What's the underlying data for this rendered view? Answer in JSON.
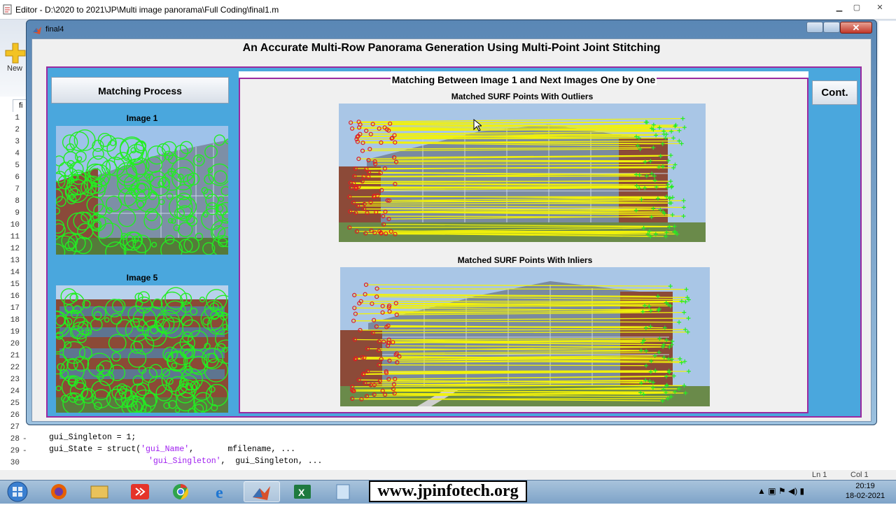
{
  "editor": {
    "title": "Editor - D:\\2020 to 2021\\JP\\Multi image panorama\\Full Coding\\final1.m",
    "new_label": "New",
    "tab_label": "fi",
    "line_numbers": [
      "1",
      "2",
      "3",
      "4",
      "5",
      "6",
      "7",
      "8",
      "9",
      "10",
      "11",
      "12",
      "13",
      "14",
      "15",
      "16",
      "17",
      "18",
      "19",
      "20",
      "21",
      "22",
      "23",
      "24",
      "25",
      "26",
      "27",
      "28",
      "29",
      "30"
    ],
    "code": {
      "line28_text": "gui_Singleton = 1;",
      "line29_prefix": "gui_State = struct(",
      "line29_str": "'gui_Name'",
      "line29_suffix": ",       mfilename, ...",
      "line30_str": "'gui_Singleton'",
      "line30_suffix": ",  gui_Singleton, ..."
    },
    "status_ln": "Ln  1",
    "status_col": "Col  1"
  },
  "figure": {
    "window_title": "final4",
    "close_glyph": "✕",
    "main_title": "An Accurate Multi-Row Panorama Generation Using Multi-Point Joint Stitching",
    "left_panel": {
      "button_label": "Matching Process",
      "image1_label": "Image 1",
      "image5_label": "Image 5"
    },
    "center_panel": {
      "title": "Matching Between Image 1 and Next Images One by One",
      "outliers_label": "Matched SURF Points With Outliers",
      "inliers_label": "Matched SURF Points With Inliers"
    },
    "cont_button_label": "Cont."
  },
  "taskbar": {
    "watermark": "www.jpinfotech.org",
    "time": "20:19",
    "date": "18-02-2021",
    "apps": [
      "windows-start",
      "firefox",
      "file-explorer",
      "anydesk",
      "chrome",
      "internet-explorer",
      "matlab",
      "excel",
      "notepad"
    ]
  },
  "colors": {
    "panel_blue": "#4aa7dd",
    "panel_border": "#9b2aa0",
    "feature_green": "#22ee22",
    "match_yellow": "#f2f20a",
    "outlier_red": "#e02020"
  }
}
